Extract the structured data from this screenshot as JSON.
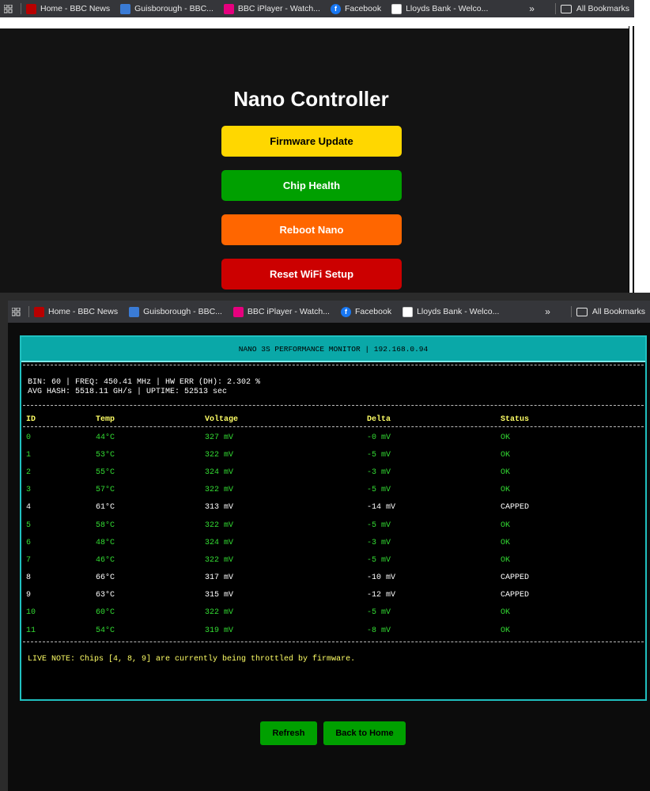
{
  "bookmarks_bar_1": {
    "items": [
      {
        "label": "Home - BBC News",
        "icon": "bbc-icon"
      },
      {
        "label": "Guisborough - BBC...",
        "icon": "weather-icon"
      },
      {
        "label": "BBC iPlayer - Watch...",
        "icon": "iplayer-icon"
      },
      {
        "label": "Facebook",
        "icon": "facebook-icon"
      },
      {
        "label": "Lloyds Bank - Welco...",
        "icon": "lloyds-icon"
      }
    ],
    "more": "»",
    "all_bookmarks": "All Bookmarks"
  },
  "controller": {
    "title": "Nano Controller",
    "buttons": {
      "firmware": "Firmware Update",
      "chip_health": "Chip Health",
      "reboot": "Reboot Nano",
      "reset_wifi": "Reset WiFi Setup"
    },
    "colors": {
      "firmware": "#ffd700",
      "chip_health": "#00a000",
      "reboot": "#ff6600",
      "reset_wifi": "#cc0000"
    }
  },
  "bookmarks_bar_2": {
    "items": [
      {
        "label": "Home - BBC News",
        "icon": "bbc-icon"
      },
      {
        "label": "Guisborough - BBC...",
        "icon": "weather-icon"
      },
      {
        "label": "BBC iPlayer - Watch...",
        "icon": "iplayer-icon"
      },
      {
        "label": "Facebook",
        "icon": "facebook-icon"
      },
      {
        "label": "Lloyds Bank - Welco...",
        "icon": "lloyds-icon"
      }
    ],
    "more": "»",
    "all_bookmarks": "All Bookmarks"
  },
  "monitor": {
    "header": "NANO 3S PERFORMANCE MONITOR | 192.168.0.94",
    "stats_line1": "BIN: 60 | FREQ: 450.41 MHz | HW ERR (DH): 2.302 %",
    "stats_line2": "AVG HASH: 5518.11 GH/s | UPTIME: 52513 sec",
    "columns": [
      "ID",
      "Temp",
      "Voltage",
      "Delta",
      "Status"
    ],
    "rows": [
      {
        "id": "0",
        "temp": "44°C",
        "voltage": "327 mV",
        "delta": "-0 mV",
        "status": "OK"
      },
      {
        "id": "1",
        "temp": "53°C",
        "voltage": "322 mV",
        "delta": "-5 mV",
        "status": "OK"
      },
      {
        "id": "2",
        "temp": "55°C",
        "voltage": "324 mV",
        "delta": "-3 mV",
        "status": "OK"
      },
      {
        "id": "3",
        "temp": "57°C",
        "voltage": "322 mV",
        "delta": "-5 mV",
        "status": "OK"
      },
      {
        "id": "4",
        "temp": "61°C",
        "voltage": "313 mV",
        "delta": "-14 mV",
        "status": "CAPPED"
      },
      {
        "id": "5",
        "temp": "58°C",
        "voltage": "322 mV",
        "delta": "-5 mV",
        "status": "OK"
      },
      {
        "id": "6",
        "temp": "48°C",
        "voltage": "324 mV",
        "delta": "-3 mV",
        "status": "OK"
      },
      {
        "id": "7",
        "temp": "46°C",
        "voltage": "322 mV",
        "delta": "-5 mV",
        "status": "OK"
      },
      {
        "id": "8",
        "temp": "66°C",
        "voltage": "317 mV",
        "delta": "-10 mV",
        "status": "CAPPED"
      },
      {
        "id": "9",
        "temp": "63°C",
        "voltage": "315 mV",
        "delta": "-12 mV",
        "status": "CAPPED"
      },
      {
        "id": "10",
        "temp": "60°C",
        "voltage": "322 mV",
        "delta": "-5 mV",
        "status": "OK"
      },
      {
        "id": "11",
        "temp": "54°C",
        "voltage": "319 mV",
        "delta": "-8 mV",
        "status": "OK"
      }
    ],
    "live_note": "LIVE NOTE: Chips [4, 8, 9] are currently being throttled by firmware.",
    "colors": {
      "ok": "#33dd33",
      "capped": "#ffffff",
      "header_bg": "#0aa8a8",
      "border": "#20c0c0"
    }
  },
  "actions": {
    "refresh": "Refresh",
    "back_home": "Back to Home"
  }
}
